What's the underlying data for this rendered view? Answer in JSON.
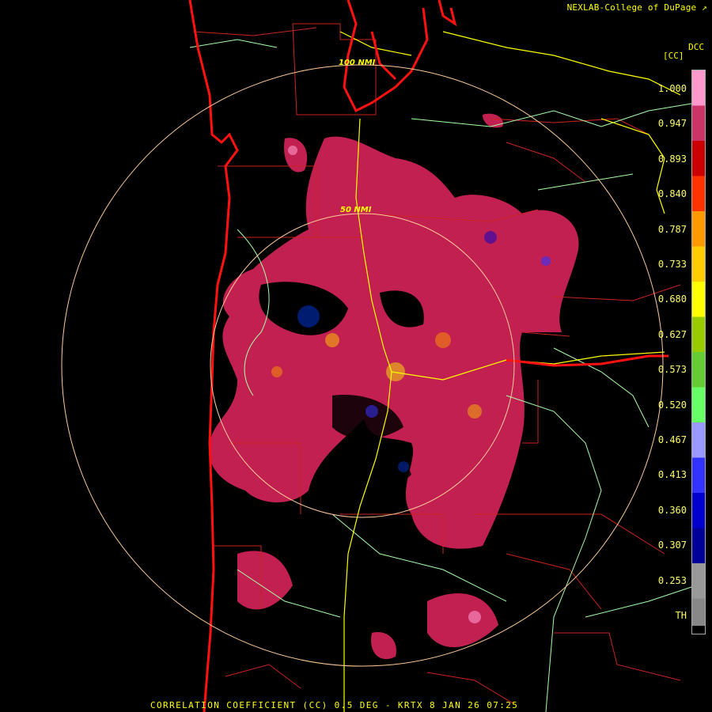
{
  "header": {
    "credit": "NEXLAB-College of DuPage",
    "product_code": "DCC",
    "units": "[CC]"
  },
  "footer": {
    "title": "CORRELATION COEFFICIENT (CC) 0.5 DEG - KRTX 8 JAN 26 07:25"
  },
  "range_rings": [
    {
      "label": "100 NMI"
    },
    {
      "label": "50 NMI"
    }
  ],
  "colorbar": {
    "labels": [
      "1.000",
      "0.947",
      "0.893",
      "0.840",
      "0.787",
      "0.733",
      "0.680",
      "0.627",
      "0.573",
      "0.520",
      "0.467",
      "0.413",
      "0.360",
      "0.307",
      "0.253",
      "TH"
    ],
    "colors": [
      "#ff99cc",
      "#cc3366",
      "#cc0000",
      "#ff3300",
      "#ff9900",
      "#ffcc00",
      "#ffff00",
      "#99cc00",
      "#66cc33",
      "#66ff66",
      "#9999ff",
      "#3333ff",
      "#0000cc",
      "#000099",
      "#999999",
      "#888888"
    ]
  },
  "map_colors": {
    "county_lines": "#cc2222",
    "state_lines": "#aaffaa",
    "highways": "#ffff00",
    "coast": "#ff1111",
    "echo_main": "#cc2255",
    "range_rings": "#ffcc99"
  }
}
